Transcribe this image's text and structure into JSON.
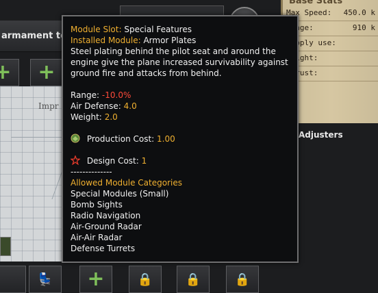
{
  "header": {
    "title": "armament to"
  },
  "grid": {
    "label": "Impr"
  },
  "stats": {
    "title": "Base Stats",
    "rows": [
      {
        "label": "Max Speed:",
        "value": "450.0 k"
      },
      {
        "label": "Range:",
        "value": "910 k"
      },
      {
        "label": "Supply use:",
        "value": ""
      },
      {
        "label": "Weight:",
        "value": ""
      },
      {
        "label": "Thrust:",
        "value": ""
      }
    ]
  },
  "adjusters_label": "Adjusters",
  "tooltip": {
    "module_slot_label": "Module Slot:",
    "module_slot_value": "Special Features",
    "installed_label": "Installed Module:",
    "installed_value": "Armor Plates",
    "description": "Steel plating behind the pilot seat and around the engine give the plane increased survivability against ground fire and attacks from behind.",
    "range_label": "Range:",
    "range_value": "-10.0%",
    "air_defense_label": "Air Defense:",
    "air_defense_value": "4.0",
    "weight_label": "Weight:",
    "weight_value": "2.0",
    "production_cost_label": "Production Cost:",
    "production_cost_value": "1.00",
    "design_cost_label": "Design Cost:",
    "design_cost_value": "1",
    "separator": "--------------",
    "allowed_header": "Allowed Module Categories",
    "allowed_categories": [
      "Special Modules (Small)",
      "Bomb Sights",
      "Radio Navigation",
      "Air-Ground Radar",
      "Air-Air Radar",
      "Defense Turrets"
    ]
  },
  "slots": {
    "plus_glyph": "+",
    "lock_glyph": "🔒"
  },
  "colors": {
    "gold": "#f0b030",
    "negative": "#ff4a3a",
    "plus_green": "#7fbf5a"
  }
}
